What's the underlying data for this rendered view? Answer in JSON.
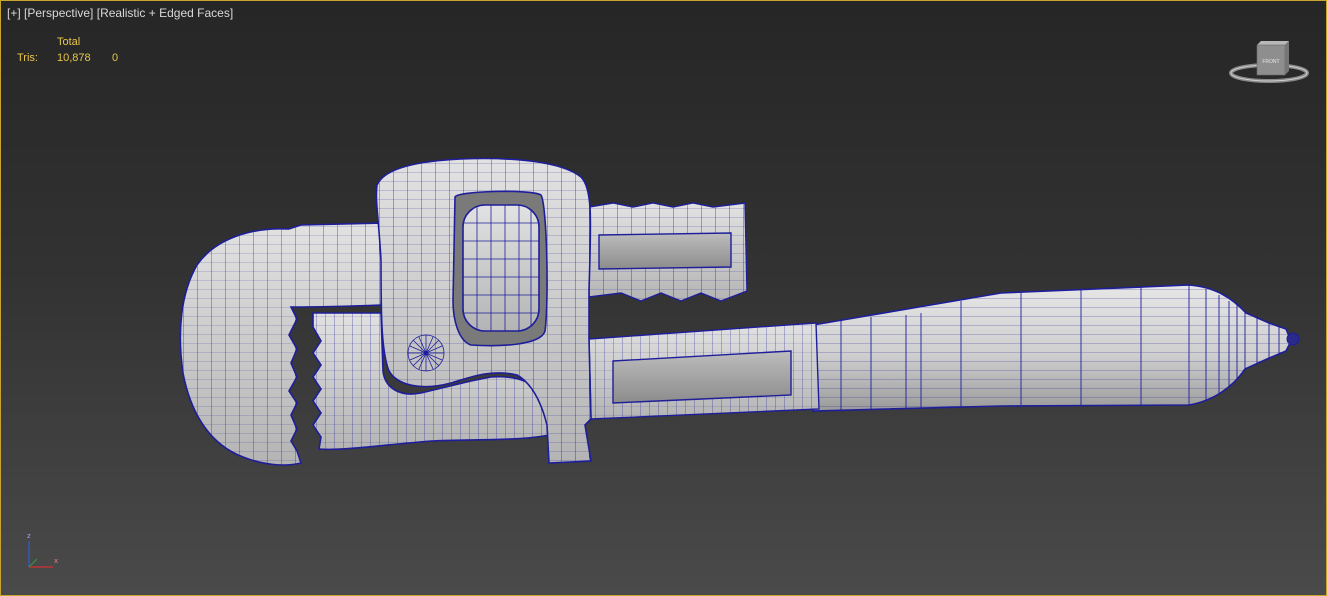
{
  "viewport": {
    "label_open": "[+]",
    "label_view": "[Perspective]",
    "label_shading": "[Realistic + Edged Faces]"
  },
  "stats": {
    "column_header": "Total",
    "row_label": "Tris:",
    "total_value": "10,878",
    "selected_value": "0"
  },
  "viewcube": {
    "face_label": "FRONT"
  },
  "axis_tripod": {
    "z_label": "z",
    "x_label": "x"
  },
  "colors": {
    "frame_border": "#c8a52e",
    "stats_text": "#e8c64a",
    "wire": "#1e1e9a",
    "mesh_fill": "#cfcfcf"
  }
}
